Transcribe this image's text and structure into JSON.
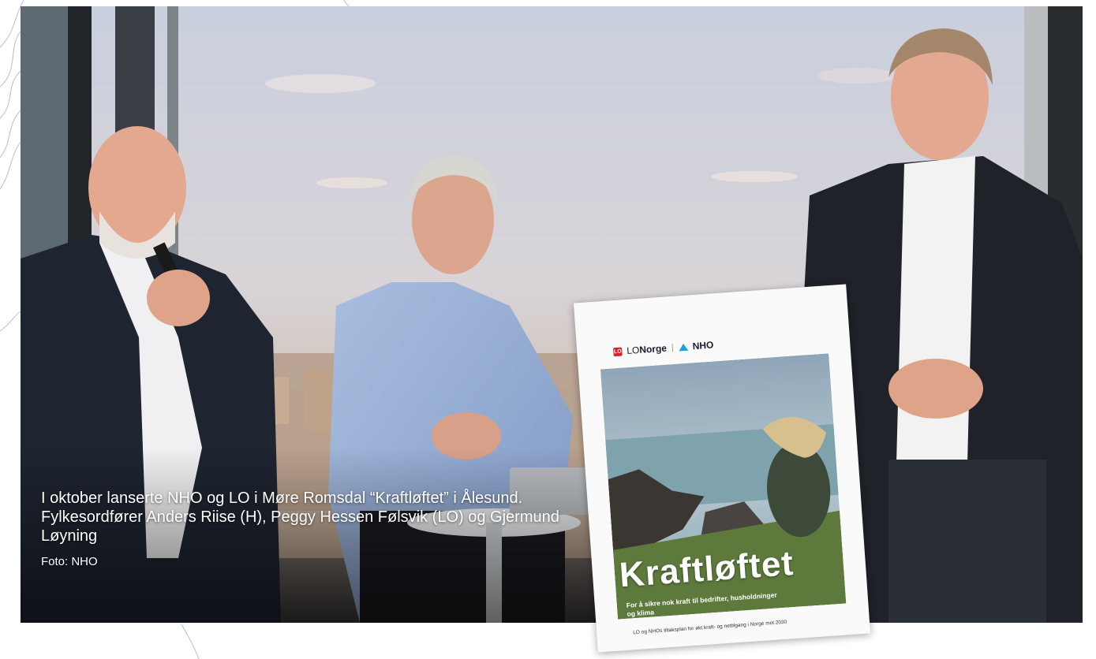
{
  "photo": {
    "caption": "I oktober lanserte NHO og LO i Møre Romsdal “Kraftløftet” i Ålesund. Fylkesordfører Anders Riise (H), Peggy Hessen Følsvik (LO) og Gjermund Løyning",
    "credit": "Foto: NHO",
    "subjects": [
      "man-speaking-with-microphone",
      "woman-in-light-blue-shirt",
      "man-with-lanyard"
    ]
  },
  "brochure": {
    "logo_lo_badge": "LO",
    "logo_lo_prefix": "LO",
    "logo_lo_name": "Norge",
    "logo_divider": "|",
    "logo_nho": "NHO",
    "title": "Kraftløftet",
    "subtitle": "For å sikre nok kraft til bedrifter, husholdninger og klima",
    "footer": "LO og NHOs tiltaksplan for økt kraft- og nettilgang i Norge mot 2030"
  },
  "colors": {
    "lo_red": "#d6202a",
    "nho_blue": "#1fa0d8",
    "caption_text": "#ffffff"
  }
}
